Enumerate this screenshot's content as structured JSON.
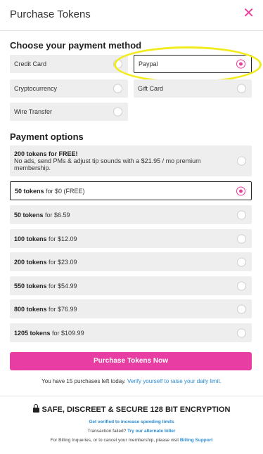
{
  "header": {
    "title": "Purchase Tokens",
    "close_icon": "close-icon"
  },
  "payment_method": {
    "title": "Choose your payment method",
    "options": [
      {
        "label": "Credit Card",
        "selected": false
      },
      {
        "label": "Paypal",
        "selected": true
      },
      {
        "label": "Cryptocurrency",
        "selected": false
      },
      {
        "label": "Gift Card",
        "selected": false
      },
      {
        "label": "Wire Transfer",
        "selected": false
      }
    ]
  },
  "payment_options": {
    "title": "Payment options",
    "promo": {
      "headline": "200 tokens for FREE!",
      "text": "No ads, send PMs & adjust tip sounds with a $21.95 / mo premium membership."
    },
    "items": [
      {
        "tokens": "50 tokens",
        "price": " for $0 (FREE)",
        "selected": true
      },
      {
        "tokens": "50 tokens",
        "price": " for $6.59",
        "selected": false
      },
      {
        "tokens": "100 tokens",
        "price": " for $12.09",
        "selected": false
      },
      {
        "tokens": "200 tokens",
        "price": " for $23.09",
        "selected": false
      },
      {
        "tokens": "550 tokens",
        "price": " for $54.99",
        "selected": false
      },
      {
        "tokens": "800 tokens",
        "price": " for $76.99",
        "selected": false
      },
      {
        "tokens": "1205 tokens",
        "price": " for $109.99",
        "selected": false
      }
    ]
  },
  "purchase": {
    "button_label": "Purchase Tokens Now",
    "limit_text": "You have 15 purchases left today.",
    "limit_link": "Verify yourself to raise your daily limit."
  },
  "security": {
    "title": "SAFE, DISCREET & SECURE 128 BIT ENCRYPTION",
    "verify_link": "Get verified to increase spending limits",
    "failed_text": "Transaction failed?",
    "alternate_link": "Try our alternate biller",
    "billing_text": "For Billing Inqueries, or to cancel your membership, please visit",
    "billing_link": "Billing Support"
  },
  "colors": {
    "accent": "#e83ea4",
    "link": "#2a8bd1",
    "highlight": "#f2ec1f"
  }
}
